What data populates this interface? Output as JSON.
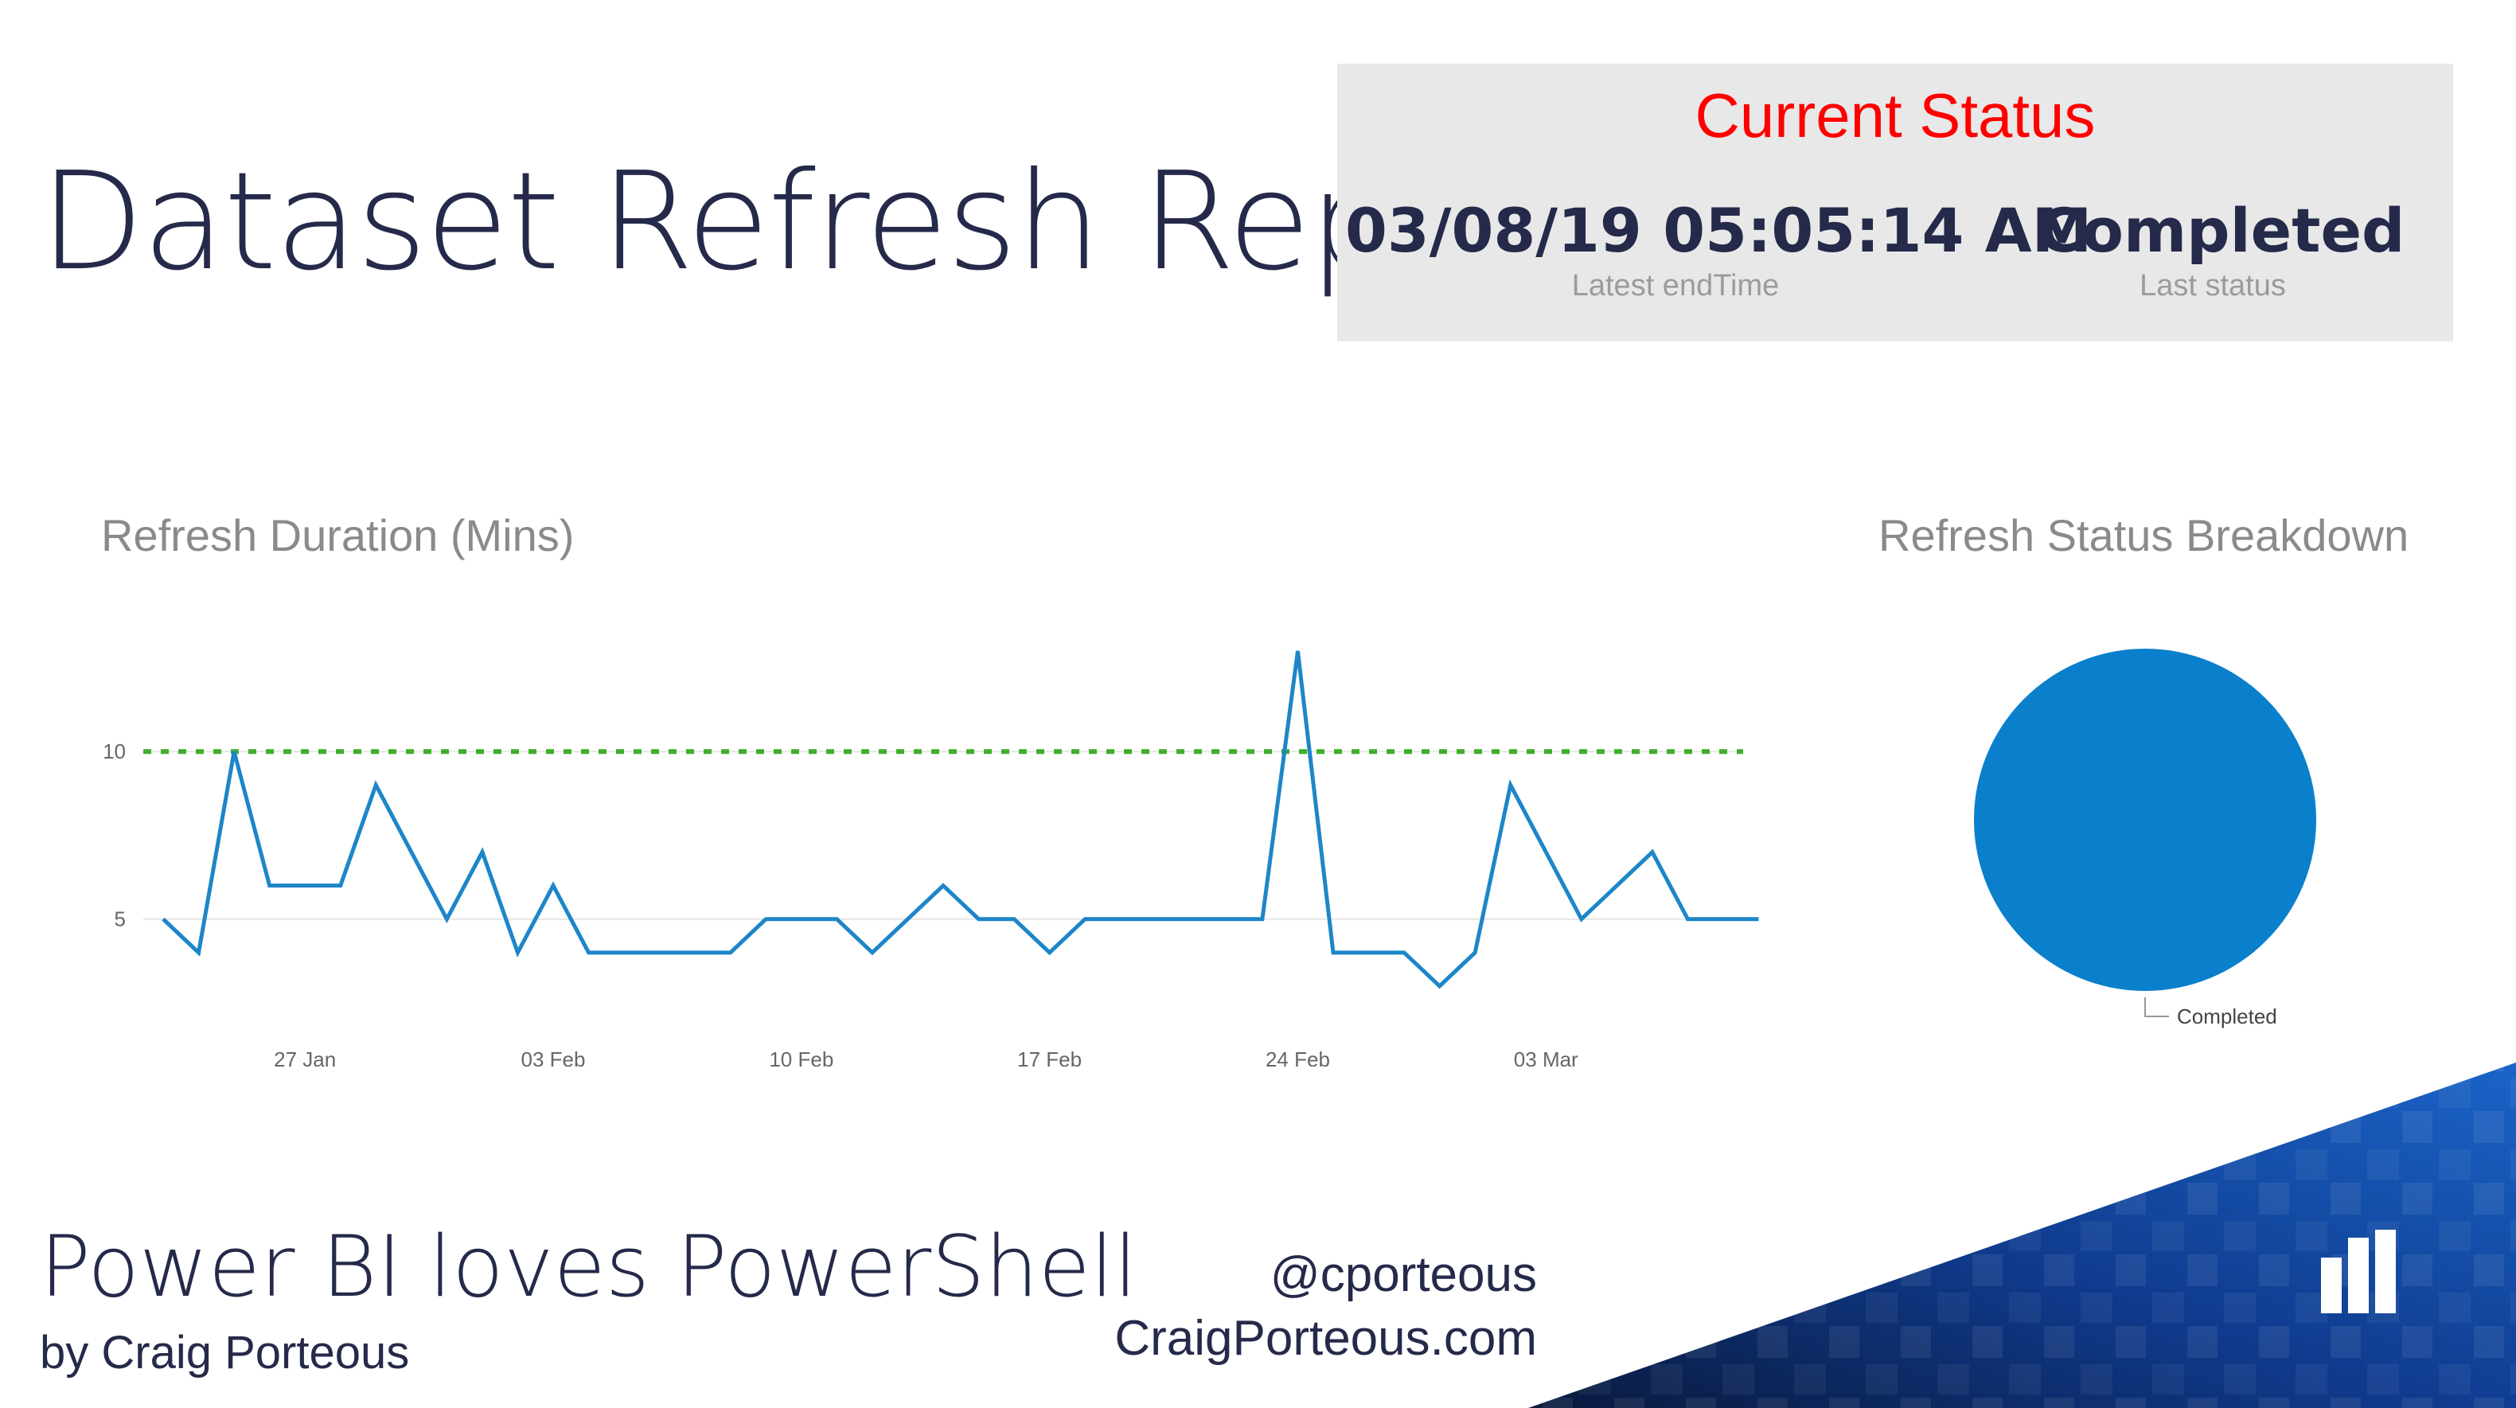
{
  "header": {
    "title": "Dataset Refresh Report"
  },
  "status_card": {
    "title": "Current Status",
    "latest_end_time": "03/08/19 05:05:14 AM",
    "latest_end_time_label": "Latest endTime",
    "last_status": "Completed",
    "last_status_label": "Last status"
  },
  "line_chart_title": "Refresh Duration (Mins)",
  "pie_chart_title": "Refresh Status Breakdown",
  "footer": {
    "main": "Power BI loves PowerShell",
    "sub": "by Craig Porteous",
    "handle": "@cporteous",
    "site": "CraigPorteous.com"
  },
  "colors": {
    "line": "#1d86c8",
    "threshold": "#3fae2a",
    "pie": "#0a7fcb",
    "status_title": "#ff0000",
    "title_text": "#252a4a"
  },
  "chart_data": [
    {
      "type": "line",
      "title": "Refresh Duration (Mins)",
      "x_start": "2019-01-23",
      "x_end": "2019-03-08",
      "x_tick_labels": [
        "27 Jan",
        "03 Feb",
        "10 Feb",
        "17 Feb",
        "24 Feb",
        "03 Mar"
      ],
      "y_ticks": [
        5,
        10
      ],
      "ylim": [
        2.5,
        12
      ],
      "threshold": 10,
      "series": [
        {
          "values": [
            5,
            4,
            10,
            6,
            6,
            6,
            9,
            7,
            5,
            7,
            4,
            6,
            4,
            4,
            4,
            4,
            4,
            5,
            5,
            5,
            4,
            5,
            6,
            5,
            5,
            4,
            5,
            5,
            5,
            5,
            5,
            5,
            13,
            4,
            4,
            4,
            3,
            4,
            9,
            7,
            5,
            6,
            7,
            5,
            5,
            5
          ]
        }
      ],
      "grid": true
    },
    {
      "type": "pie",
      "title": "Refresh Status Breakdown",
      "categories": [
        "Completed"
      ],
      "values": [
        100
      ]
    }
  ]
}
